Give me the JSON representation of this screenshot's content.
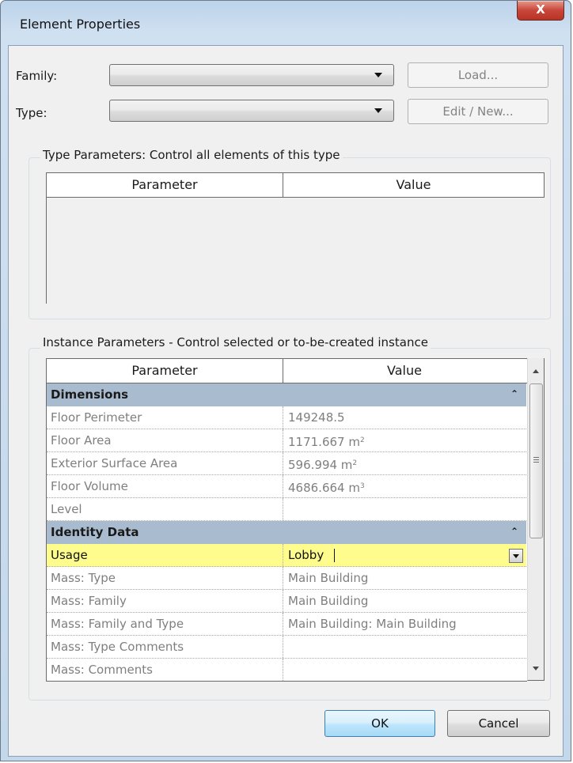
{
  "window": {
    "title": "Element Properties",
    "close_glyph": "X"
  },
  "family": {
    "label": "Family:",
    "value": "",
    "load_button": "Load..."
  },
  "type": {
    "label": "Type:",
    "value": "",
    "edit_button": "Edit / New..."
  },
  "type_parameters": {
    "title": "Type Parameters: Control all elements of this type",
    "columns": [
      "Parameter",
      "Value"
    ]
  },
  "instance_parameters": {
    "title": "Instance Parameters - Control selected or to-be-created instance",
    "columns": [
      "Parameter",
      "Value"
    ],
    "groups": [
      {
        "name": "Dimensions",
        "collapse_glyph": "⌃",
        "rows": [
          {
            "parameter": "Floor Perimeter",
            "value": "149248.5",
            "unit": ""
          },
          {
            "parameter": "Floor Area",
            "value": "1171.667 m",
            "unit": "2"
          },
          {
            "parameter": "Exterior Surface Area",
            "value": "596.994 m",
            "unit": "2"
          },
          {
            "parameter": "Floor Volume",
            "value": "4686.664 m",
            "unit": "3"
          },
          {
            "parameter": "Level",
            "value": "",
            "unit": ""
          }
        ]
      },
      {
        "name": "Identity Data",
        "collapse_glyph": "⌃",
        "rows": [
          {
            "parameter": "Usage",
            "value": "Lobby",
            "unit": ""
          },
          {
            "parameter": "Mass: Type",
            "value": "Main Building",
            "unit": ""
          },
          {
            "parameter": "Mass: Family",
            "value": "Main Building",
            "unit": ""
          },
          {
            "parameter": "Mass: Family and Type",
            "value": "Main Building: Main Building",
            "unit": ""
          },
          {
            "parameter": "Mass: Type Comments",
            "value": "",
            "unit": ""
          },
          {
            "parameter": "Mass: Comments",
            "value": "",
            "unit": ""
          }
        ]
      }
    ]
  },
  "buttons": {
    "ok": "OK",
    "cancel": "Cancel"
  },
  "colors": {
    "category_header": "#a9bbce",
    "active_row": "#fdfc8c",
    "inactive_text": "#7f7f7f"
  }
}
